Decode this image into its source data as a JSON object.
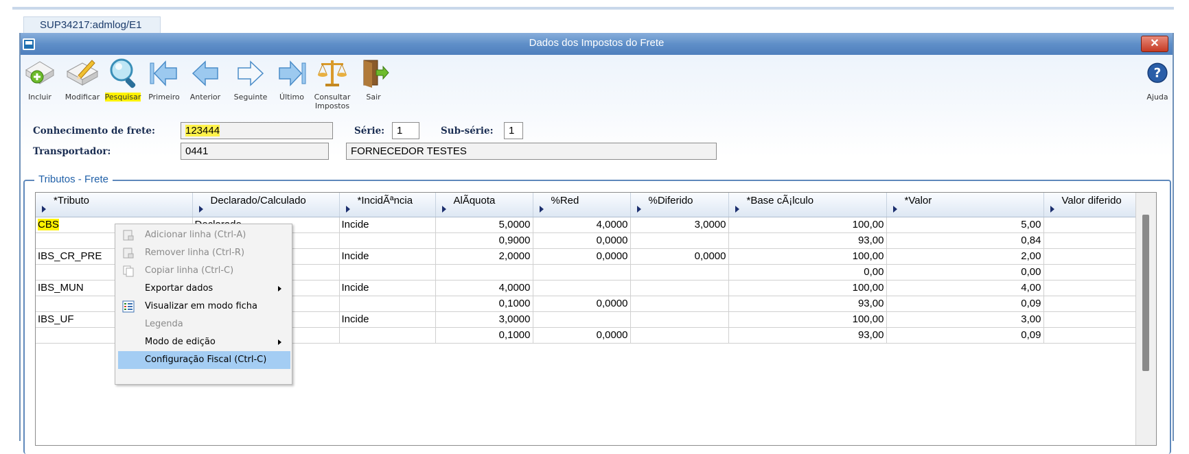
{
  "tab": {
    "label": "SUP34217:admlog/E1"
  },
  "window": {
    "title": "Dados dos Impostos do Frete",
    "close": "✕"
  },
  "toolbar": {
    "incluir": "Incluir",
    "modificar": "Modificar",
    "pesquisar": "Pesquisar",
    "primeiro": "Primeiro",
    "anterior": "Anterior",
    "seguinte": "Seguinte",
    "ultimo": "Último",
    "consultar": "Consultar\nImpostos",
    "sair": "Sair",
    "ajuda": "Ajuda"
  },
  "form": {
    "conhecimento_label": "Conhecimento de frete:",
    "conhecimento_value": "123444",
    "serie_label": "Série:",
    "serie_value": "1",
    "subserie_label": "Sub-série:",
    "subserie_value": "1",
    "transportador_label": "Transportador:",
    "transportador_code": "0441",
    "transportador_name": "FORNECEDOR TESTES"
  },
  "group": {
    "legend": "Tributos - Frete"
  },
  "grid": {
    "columns": [
      "*Tributo",
      "Declarado/Calculado",
      "*IncidÃªncia",
      "AlÃquota",
      "%Red",
      "%Diferido",
      "*Base cÃ¡lculo",
      "*Valor",
      "Valor diferido"
    ],
    "rows": [
      [
        "CBS",
        "Declarado",
        "Incide",
        "5,0000",
        "4,0000",
        "3,0000",
        "100,00",
        "5,00",
        ""
      ],
      [
        "",
        "",
        "",
        "0,9000",
        "0,0000",
        "",
        "93,00",
        "0,84",
        ""
      ],
      [
        "IBS_CR_PRE",
        "",
        "Incide",
        "2,0000",
        "0,0000",
        "0,0000",
        "100,00",
        "2,00",
        ""
      ],
      [
        "",
        "",
        "",
        "",
        "",
        "",
        "0,00",
        "0,00",
        ""
      ],
      [
        "IBS_MUN",
        "",
        "Incide",
        "4,0000",
        "",
        "",
        "100,00",
        "4,00",
        ""
      ],
      [
        "",
        "",
        "",
        "0,1000",
        "0,0000",
        "",
        "93,00",
        "0,09",
        ""
      ],
      [
        "IBS_UF",
        "",
        "Incide",
        "3,0000",
        "",
        "",
        "100,00",
        "3,00",
        ""
      ],
      [
        "",
        "",
        "",
        "0,1000",
        "0,0000",
        "",
        "93,00",
        "0,09",
        ""
      ]
    ]
  },
  "context_menu": {
    "items": [
      {
        "label": "Adicionar linha (Ctrl-A)",
        "enabled": false,
        "icon": "add-row-icon"
      },
      {
        "label": "Remover linha (Ctrl-R)",
        "enabled": false,
        "icon": "remove-row-icon"
      },
      {
        "label": "Copiar linha (Ctrl-C)",
        "enabled": false,
        "icon": "copy-row-icon"
      },
      {
        "label": "Exportar dados",
        "enabled": true,
        "submenu": true
      },
      {
        "label": "Visualizar em modo ficha",
        "enabled": true,
        "icon": "form-view-icon"
      },
      {
        "label": "Legenda",
        "enabled": false
      },
      {
        "label": "Modo de edição",
        "enabled": true,
        "submenu": true
      },
      {
        "label": "Configuração Fiscal (Ctrl-C)",
        "enabled": true,
        "selected": true
      }
    ]
  },
  "colors": {
    "accent": "#5f8fc8",
    "highlight": "#fff200",
    "selection": "#a4cdf3"
  }
}
